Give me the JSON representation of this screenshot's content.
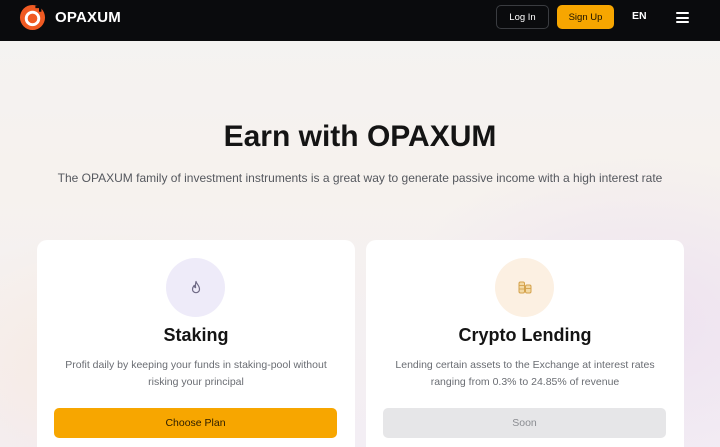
{
  "header": {
    "brand": "OPAXUM",
    "login_label": "Log In",
    "signup_label": "Sign Up",
    "language": "EN",
    "icons": {
      "logo": "opaxum-logo-icon",
      "menu": "hamburger-menu-icon"
    }
  },
  "hero": {
    "title": "Earn with OPAXUM",
    "subtitle": "The OPAXUM family of investment instruments is a great way to generate passive income with a high interest rate"
  },
  "cards": [
    {
      "icon": "flame-icon",
      "title": "Staking",
      "description": "Profit daily by keeping your funds in staking-pool without risking your principal",
      "button_label": "Choose Plan"
    },
    {
      "icon": "coins-icon",
      "title": "Crypto Lending",
      "description": "Lending certain assets to the Exchange at interest rates ranging from 0.3% to 24.85% of revenue",
      "button_label": "Soon"
    }
  ],
  "colors": {
    "accent": "#f7a600",
    "header_bg": "#0a0b0d",
    "logo_orange": "#f05a22",
    "staking_icon_bg": "#eeebf9",
    "lending_icon_bg": "#fcf0e2",
    "disabled_button": "#e6e6e8"
  }
}
